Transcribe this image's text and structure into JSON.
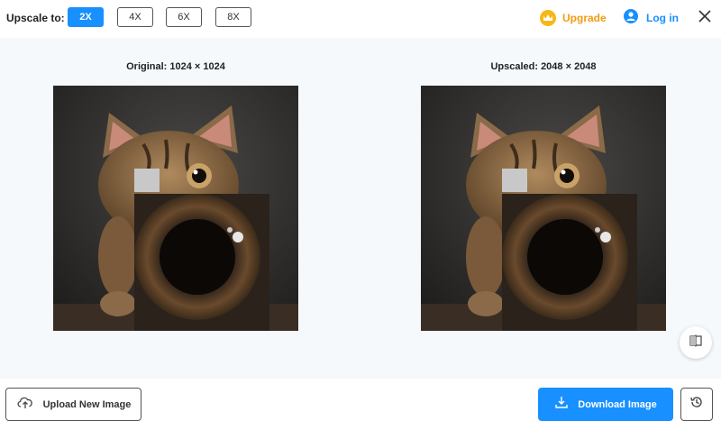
{
  "toolbar": {
    "upscale_label": "Upscale to:",
    "scales": [
      "2X",
      "4X",
      "6X",
      "8X"
    ],
    "selected_scale": "2X",
    "upgrade_label": "Upgrade",
    "upgrade_icon": "crown-icon",
    "login_label": "Log in",
    "login_icon": "user-icon",
    "close_icon": "close-icon"
  },
  "preview": {
    "original_caption": "Original: 1024 × 1024",
    "upscaled_caption": "Upscaled: 2048 × 2048",
    "image_subject": "cat-with-camera-lens",
    "compare_icon": "split-compare-icon"
  },
  "actions": {
    "upload_label": "Upload New Image",
    "upload_icon": "cloud-upload-icon",
    "download_label": "Download Image",
    "download_icon": "download-icon",
    "history_icon": "history-icon"
  },
  "colors": {
    "accent": "#1890ff",
    "upgrade": "#f39c12",
    "preview_bg": "#f5f9fc"
  }
}
